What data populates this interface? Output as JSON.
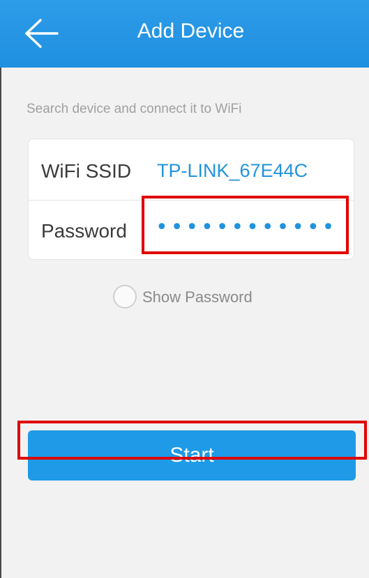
{
  "header": {
    "title": "Add Device",
    "back_icon": "back-arrow-icon"
  },
  "subtitle": "Search device and connect it to WiFi",
  "form": {
    "ssid_label": "WiFi SSID",
    "ssid_value": "TP-LINK_67E44C",
    "password_label": "Password",
    "password_value": "••••••••••••"
  },
  "show_password": {
    "label": "Show Password",
    "checked": false
  },
  "start_button": {
    "label": "Start"
  },
  "colors": {
    "header": "#1f8fe0",
    "accent": "#2193dd",
    "button": "#1e9ae6",
    "highlight": "#e00000"
  }
}
